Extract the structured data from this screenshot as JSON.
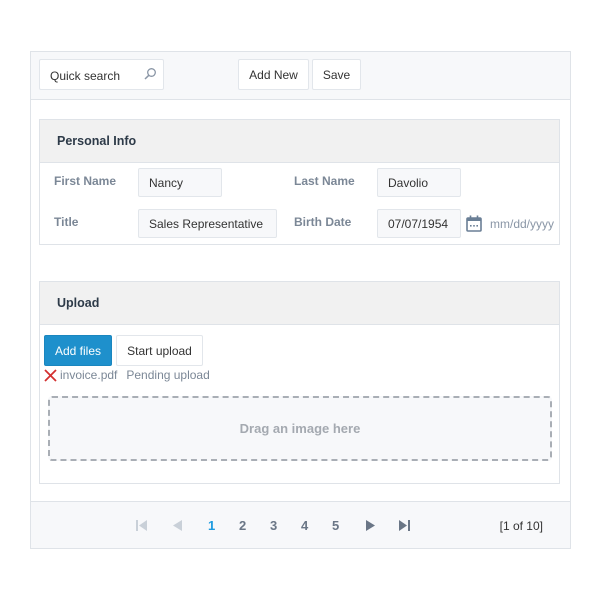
{
  "toolbar": {
    "search": {
      "placeholder": "Quick search",
      "icon": "search-icon"
    },
    "add_new_label": "Add New",
    "save_label": "Save"
  },
  "personal_info": {
    "title": "Personal Info",
    "fields": {
      "first_name": {
        "label": "First Name",
        "value": "Nancy"
      },
      "last_name": {
        "label": "Last Name",
        "value": "Davolio"
      },
      "title": {
        "label": "Title",
        "value": "Sales Representative"
      },
      "birth_date": {
        "label": "Birth Date",
        "value": "07/07/1954",
        "format_hint": "mm/dd/yyyy",
        "icon": "calendar-icon"
      }
    }
  },
  "upload": {
    "title": "Upload",
    "add_files_label": "Add files",
    "start_upload_label": "Start upload",
    "files": [
      {
        "name": "invoice.pdf",
        "status": "Pending upload",
        "remove_icon": "remove-x-icon"
      }
    ],
    "dropzone_text": "Drag an image here"
  },
  "pager": {
    "pages": [
      "1",
      "2",
      "3",
      "4",
      "5"
    ],
    "current_page": "1",
    "info": "[1 of 10]"
  },
  "colors": {
    "accent": "#1e90cc",
    "active_page": "#1e9be0",
    "remove_icon": "#d32f2f",
    "label": "#7b8796"
  }
}
